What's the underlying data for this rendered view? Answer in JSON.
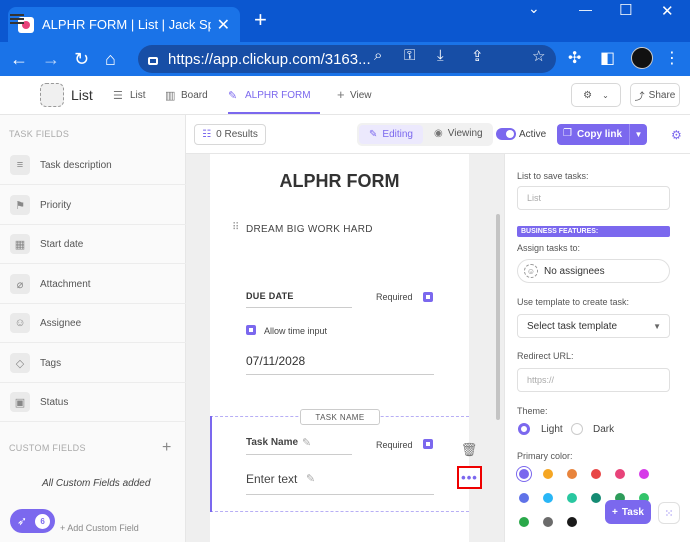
{
  "browser": {
    "tab_title": "ALPHR FORM | List | Jack Sparrow",
    "tab_close": "✕",
    "new_tab": "+",
    "url": "https://app.clickup.com/3163...",
    "minimize": "⌄",
    "restore": "—",
    "maximize": "☐",
    "close": "✕"
  },
  "header": {
    "list_title": "List",
    "views": [
      "List",
      "Board",
      "ALPHR FORM"
    ],
    "add_view": "View",
    "share": "Share"
  },
  "toolbar": {
    "results": "0 Results",
    "editing": "Editing",
    "viewing": "Viewing",
    "active": "Active",
    "copy_link": "Copy link"
  },
  "left_panel": {
    "task_fields_title": "TASK FIELDS",
    "task_fields": [
      "Task description",
      "Priority",
      "Start date",
      "Attachment",
      "Assignee",
      "Tags",
      "Status"
    ],
    "custom_fields_title": "CUSTOM FIELDS",
    "all_custom": "All Custom Fields added",
    "add_custom": "+ Add Custom Field",
    "notifications_count": "6"
  },
  "form": {
    "title": "ALPHR FORM",
    "description": "DREAM BIG WORK HARD",
    "due_date_label": "DUE DATE",
    "required": "Required",
    "allow_time": "Allow time input",
    "due_date_value": "07/11/2028",
    "task_name_chip": "TASK NAME",
    "task_name_label": "Task Name",
    "task_name_placeholder": "Enter text"
  },
  "right_panel": {
    "list_to_save": "List to save tasks:",
    "list_placeholder": "List",
    "business_features": "BUSINESS FEATURES:",
    "assign_label": "Assign tasks to:",
    "no_assignees": "No assignees",
    "template_label": "Use template to create task:",
    "template_value": "Select task template",
    "redirect_label": "Redirect URL:",
    "redirect_placeholder": "https://",
    "theme_label": "Theme:",
    "light": "Light",
    "dark": "Dark",
    "primary_color_label": "Primary color:",
    "colors": [
      "#7b68ee",
      "#f5a623",
      "#e8843c",
      "#e84545",
      "#e8437a",
      "#d63ae8",
      "#5f72e8",
      "#29b6f6",
      "#29c7a0",
      "#158b73",
      "#2e9c5a",
      "#33c46a",
      "#2aa84a",
      "#6b6b6b",
      "#1a1a1a"
    ],
    "task_button": "Task"
  },
  "theme": {
    "accent": "#7b68ee",
    "chrome_blue": "#1a73e8",
    "highlight_red": "#e00000"
  }
}
